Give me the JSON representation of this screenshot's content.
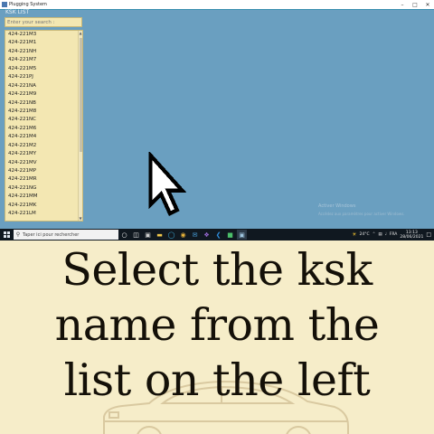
{
  "window": {
    "title": "Plugging System",
    "list_header": "KSK LIST",
    "search_placeholder": "Enter your search :",
    "items": [
      "424-221M3",
      "424-221M1",
      "424-221NH",
      "424-221M7",
      "424-221M5",
      "424-221PJ",
      "424-221NA",
      "424-221M9",
      "424-221NB",
      "424-221M8",
      "424-221NC",
      "424-221M6",
      "424-221M4",
      "424-221M2",
      "424-221MY",
      "424-221MV",
      "424-221MP",
      "424-221MR",
      "424-221NG",
      "424-221MM",
      "424-221MK",
      "424-221LM"
    ],
    "watermark_line1": "Activer Windows",
    "watermark_line2": "Accédez aux paramètres pour activer Windows."
  },
  "taskbar": {
    "search_placeholder": "Taper ici pour rechercher",
    "temperature": "24°C",
    "language": "FRA",
    "time": "13:13",
    "date": "28/06/2021"
  },
  "caption": {
    "line1": "Select the ksk",
    "line2": "name from the",
    "line3": "list on the left"
  },
  "colors": {
    "window_bg": "#6a9fc0",
    "list_bg": "#f3e7b2",
    "caption_bg": "#f6edc9",
    "taskbar_bg": "#101820"
  }
}
